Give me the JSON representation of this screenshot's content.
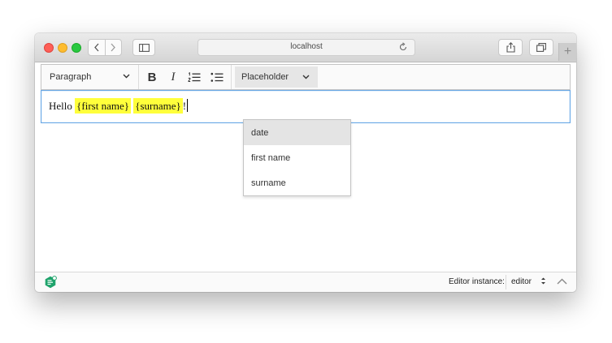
{
  "browser": {
    "url": "localhost",
    "new_tab_label": "+"
  },
  "toolbar": {
    "heading": "Paragraph",
    "bold_label": "B",
    "italic_label": "I",
    "placeholder_label": "Placeholder"
  },
  "content": {
    "prefix": "Hello",
    "placeholders": [
      "{first name}",
      "{surname}"
    ],
    "suffix": "!"
  },
  "dropdown": {
    "items": [
      "date",
      "first name",
      "surname"
    ],
    "active_item": "date"
  },
  "statusbar": {
    "instance_label": "Editor instance:",
    "instance_value": "editor"
  },
  "colors": {
    "placeholder_highlight": "#ffff3b",
    "focus_border": "#6aa9e6",
    "logo_green": "#1ea36b"
  }
}
